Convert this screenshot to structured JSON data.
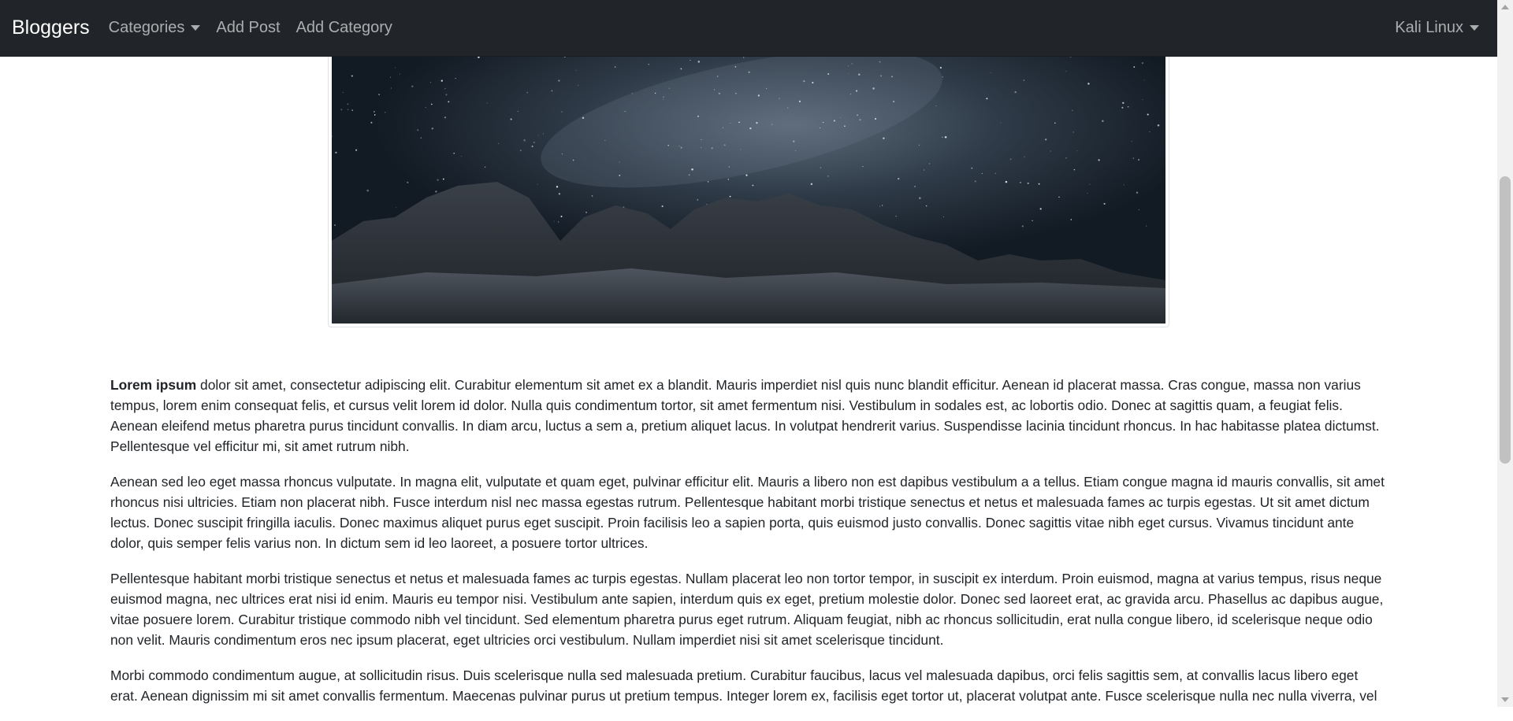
{
  "navbar": {
    "brand": "Bloggers",
    "links": [
      "Categories",
      "Add Post",
      "Add Category"
    ],
    "user": "Kali Linux"
  },
  "post": {
    "lead_bold": "Lorem ipsum",
    "paragraphs": [
      " dolor sit amet, consectetur adipiscing elit. Curabitur elementum sit amet ex a blandit. Mauris imperdiet nisl quis nunc blandit efficitur. Aenean id placerat massa. Cras congue, massa non varius tempus, lorem enim consequat felis, et cursus velit lorem id dolor. Nulla quis condimentum tortor, sit amet fermentum nisi. Vestibulum in sodales est, ac lobortis odio. Donec at sagittis quam, a feugiat felis. Aenean eleifend metus pharetra purus tincidunt convallis. In diam arcu, luctus a sem a, pretium aliquet lacus. In volutpat hendrerit varius. Suspendisse lacinia tincidunt rhoncus. In hac habitasse platea dictumst. Pellentesque vel efficitur mi, sit amet rutrum nibh.",
      "Aenean sed leo eget massa rhoncus vulputate. In magna elit, vulputate et quam eget, pulvinar efficitur elit. Mauris a libero non est dapibus vestibulum a a tellus. Etiam congue magna id mauris convallis, sit amet rhoncus nisi ultricies. Etiam non placerat nibh. Fusce interdum nisl nec massa egestas rutrum. Pellentesque habitant morbi tristique senectus et netus et malesuada fames ac turpis egestas. Ut sit amet dictum lectus. Donec suscipit fringilla iaculis. Donec maximus aliquet purus eget suscipit. Proin facilisis leo a sapien porta, quis euismod justo convallis. Donec sagittis vitae nibh eget cursus. Vivamus tincidunt ante dolor, quis semper felis varius non. In dictum sem id leo laoreet, a posuere tortor ultrices.",
      "Pellentesque habitant morbi tristique senectus et netus et malesuada fames ac turpis egestas. Nullam placerat leo non tortor tempor, in suscipit ex interdum. Proin euismod, magna at varius tempus, risus neque euismod magna, nec ultrices erat nisi id enim. Mauris eu tempor nisi. Vestibulum ante sapien, interdum quis ex eget, pretium molestie dolor. Donec sed laoreet erat, ac gravida arcu. Phasellus ac dapibus augue, vitae posuere lorem. Curabitur tristique commodo nibh vel tincidunt. Sed elementum pharetra purus eget rutrum. Aliquam feugiat, nibh ac rhoncus sollicitudin, erat nulla congue libero, id scelerisque neque odio non velit. Mauris condimentum eros nec ipsum placerat, eget ultricies orci vestibulum. Nullam imperdiet nisi sit amet scelerisque tincidunt.",
      "Morbi commodo condimentum augue, at sollicitudin risus. Duis scelerisque nulla sed malesuada pretium. Curabitur faucibus, lacus vel malesuada dapibus, orci felis sagittis sem, at convallis lacus libero eget erat. Aenean dignissim mi sit amet convallis fermentum. Maecenas pulvinar purus ut pretium tempus. Integer lorem ex, facilisis eget tortor ut, placerat volutpat ante. Fusce scelerisque nulla nec nulla viverra, vel"
    ]
  },
  "colors": {
    "navbar_bg": "#212529",
    "brand": "#ffffff",
    "nav_link": "rgba(255,255,255,0.62)",
    "text": "#212529"
  },
  "icons": {
    "dropdown": "caret-down-icon"
  }
}
